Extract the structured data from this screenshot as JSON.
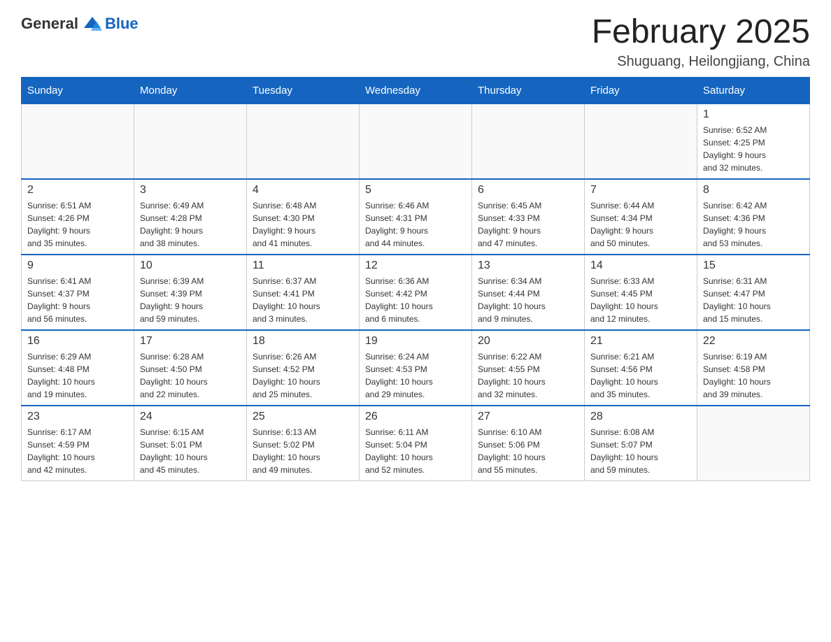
{
  "header": {
    "logo_general": "General",
    "logo_blue": "Blue",
    "month_title": "February 2025",
    "location": "Shuguang, Heilongjiang, China"
  },
  "weekdays": [
    "Sunday",
    "Monday",
    "Tuesday",
    "Wednesday",
    "Thursday",
    "Friday",
    "Saturday"
  ],
  "weeks": [
    [
      {
        "day": "",
        "info": ""
      },
      {
        "day": "",
        "info": ""
      },
      {
        "day": "",
        "info": ""
      },
      {
        "day": "",
        "info": ""
      },
      {
        "day": "",
        "info": ""
      },
      {
        "day": "",
        "info": ""
      },
      {
        "day": "1",
        "info": "Sunrise: 6:52 AM\nSunset: 4:25 PM\nDaylight: 9 hours\nand 32 minutes."
      }
    ],
    [
      {
        "day": "2",
        "info": "Sunrise: 6:51 AM\nSunset: 4:26 PM\nDaylight: 9 hours\nand 35 minutes."
      },
      {
        "day": "3",
        "info": "Sunrise: 6:49 AM\nSunset: 4:28 PM\nDaylight: 9 hours\nand 38 minutes."
      },
      {
        "day": "4",
        "info": "Sunrise: 6:48 AM\nSunset: 4:30 PM\nDaylight: 9 hours\nand 41 minutes."
      },
      {
        "day": "5",
        "info": "Sunrise: 6:46 AM\nSunset: 4:31 PM\nDaylight: 9 hours\nand 44 minutes."
      },
      {
        "day": "6",
        "info": "Sunrise: 6:45 AM\nSunset: 4:33 PM\nDaylight: 9 hours\nand 47 minutes."
      },
      {
        "day": "7",
        "info": "Sunrise: 6:44 AM\nSunset: 4:34 PM\nDaylight: 9 hours\nand 50 minutes."
      },
      {
        "day": "8",
        "info": "Sunrise: 6:42 AM\nSunset: 4:36 PM\nDaylight: 9 hours\nand 53 minutes."
      }
    ],
    [
      {
        "day": "9",
        "info": "Sunrise: 6:41 AM\nSunset: 4:37 PM\nDaylight: 9 hours\nand 56 minutes."
      },
      {
        "day": "10",
        "info": "Sunrise: 6:39 AM\nSunset: 4:39 PM\nDaylight: 9 hours\nand 59 minutes."
      },
      {
        "day": "11",
        "info": "Sunrise: 6:37 AM\nSunset: 4:41 PM\nDaylight: 10 hours\nand 3 minutes."
      },
      {
        "day": "12",
        "info": "Sunrise: 6:36 AM\nSunset: 4:42 PM\nDaylight: 10 hours\nand 6 minutes."
      },
      {
        "day": "13",
        "info": "Sunrise: 6:34 AM\nSunset: 4:44 PM\nDaylight: 10 hours\nand 9 minutes."
      },
      {
        "day": "14",
        "info": "Sunrise: 6:33 AM\nSunset: 4:45 PM\nDaylight: 10 hours\nand 12 minutes."
      },
      {
        "day": "15",
        "info": "Sunrise: 6:31 AM\nSunset: 4:47 PM\nDaylight: 10 hours\nand 15 minutes."
      }
    ],
    [
      {
        "day": "16",
        "info": "Sunrise: 6:29 AM\nSunset: 4:48 PM\nDaylight: 10 hours\nand 19 minutes."
      },
      {
        "day": "17",
        "info": "Sunrise: 6:28 AM\nSunset: 4:50 PM\nDaylight: 10 hours\nand 22 minutes."
      },
      {
        "day": "18",
        "info": "Sunrise: 6:26 AM\nSunset: 4:52 PM\nDaylight: 10 hours\nand 25 minutes."
      },
      {
        "day": "19",
        "info": "Sunrise: 6:24 AM\nSunset: 4:53 PM\nDaylight: 10 hours\nand 29 minutes."
      },
      {
        "day": "20",
        "info": "Sunrise: 6:22 AM\nSunset: 4:55 PM\nDaylight: 10 hours\nand 32 minutes."
      },
      {
        "day": "21",
        "info": "Sunrise: 6:21 AM\nSunset: 4:56 PM\nDaylight: 10 hours\nand 35 minutes."
      },
      {
        "day": "22",
        "info": "Sunrise: 6:19 AM\nSunset: 4:58 PM\nDaylight: 10 hours\nand 39 minutes."
      }
    ],
    [
      {
        "day": "23",
        "info": "Sunrise: 6:17 AM\nSunset: 4:59 PM\nDaylight: 10 hours\nand 42 minutes."
      },
      {
        "day": "24",
        "info": "Sunrise: 6:15 AM\nSunset: 5:01 PM\nDaylight: 10 hours\nand 45 minutes."
      },
      {
        "day": "25",
        "info": "Sunrise: 6:13 AM\nSunset: 5:02 PM\nDaylight: 10 hours\nand 49 minutes."
      },
      {
        "day": "26",
        "info": "Sunrise: 6:11 AM\nSunset: 5:04 PM\nDaylight: 10 hours\nand 52 minutes."
      },
      {
        "day": "27",
        "info": "Sunrise: 6:10 AM\nSunset: 5:06 PM\nDaylight: 10 hours\nand 55 minutes."
      },
      {
        "day": "28",
        "info": "Sunrise: 6:08 AM\nSunset: 5:07 PM\nDaylight: 10 hours\nand 59 minutes."
      },
      {
        "day": "",
        "info": ""
      }
    ]
  ]
}
